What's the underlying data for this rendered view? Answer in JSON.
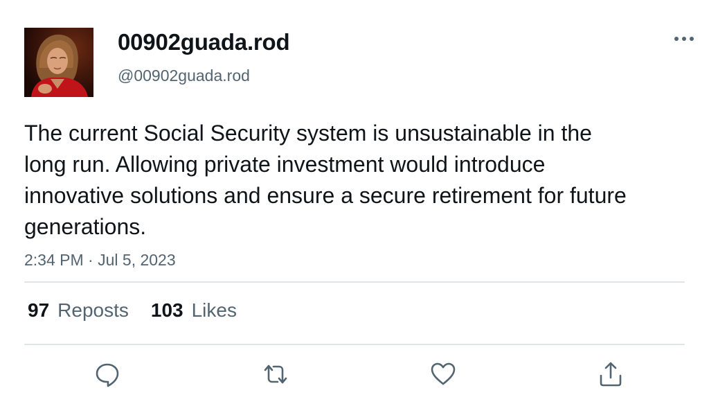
{
  "author": {
    "display_name": "00902guada.rod",
    "handle": "@00902guada.rod",
    "avatar_icon": "profile-photo"
  },
  "tweet": {
    "text": "The current Social Security system is unsustainable in the long run. Allowing private investment would introduce innovative solutions and ensure a secure retirement for future generations.",
    "time": "2:34 PM",
    "separator": "·",
    "date": "Jul 5, 2023"
  },
  "stats": {
    "reposts_count": "97",
    "reposts_label": "Reposts",
    "likes_count": "103",
    "likes_label": "Likes"
  },
  "actions": {
    "reply_icon": "reply-icon",
    "repost_icon": "repost-icon",
    "like_icon": "heart-icon",
    "share_icon": "share-icon",
    "more_icon": "more-options-icon"
  },
  "colors": {
    "text_primary": "#0f1419",
    "text_secondary": "#536471",
    "icon": "#536471",
    "divider": "#e1e4e7"
  }
}
